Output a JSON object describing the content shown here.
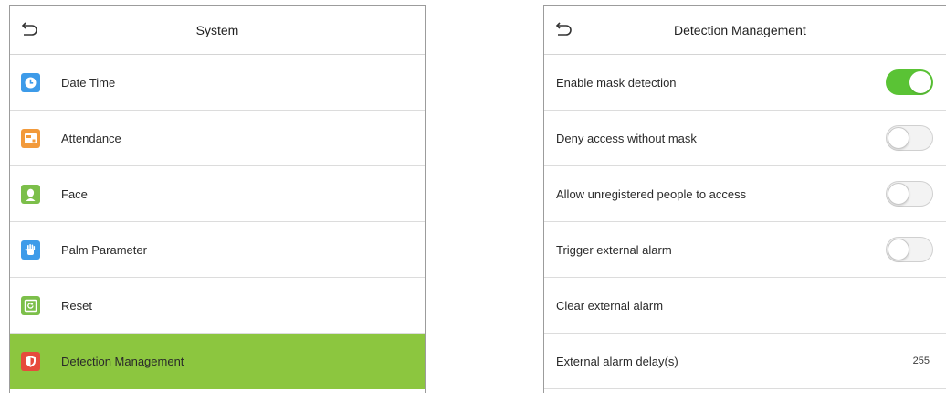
{
  "left": {
    "title": "System",
    "items": [
      {
        "label": "Date Time",
        "icon": "clock-icon",
        "color": "#3d9be9",
        "active": false
      },
      {
        "label": "Attendance",
        "icon": "attendance-icon",
        "color": "#f29a3b",
        "active": false
      },
      {
        "label": "Face",
        "icon": "face-icon",
        "color": "#7cbf4a",
        "active": false
      },
      {
        "label": "Palm Parameter",
        "icon": "palm-icon",
        "color": "#3d9be9",
        "active": false
      },
      {
        "label": "Reset",
        "icon": "reset-icon",
        "color": "#7cbf4a",
        "active": false
      },
      {
        "label": "Detection Management",
        "icon": "shield-icon",
        "color": "#e64b3c",
        "active": true
      }
    ]
  },
  "right": {
    "title": "Detection Management",
    "settings": [
      {
        "label": "Enable mask detection",
        "toggle": true
      },
      {
        "label": "Deny access without mask",
        "toggle": false
      },
      {
        "label": "Allow unregistered people to access",
        "toggle": false
      },
      {
        "label": "Trigger external alarm",
        "toggle": false
      },
      {
        "label": "Clear external alarm"
      },
      {
        "label": "External alarm delay(s)",
        "value": "255"
      }
    ]
  },
  "colors": {
    "active_row": "#8cc63f",
    "toggle_on": "#5ac335",
    "border": "#dcdcdc"
  }
}
